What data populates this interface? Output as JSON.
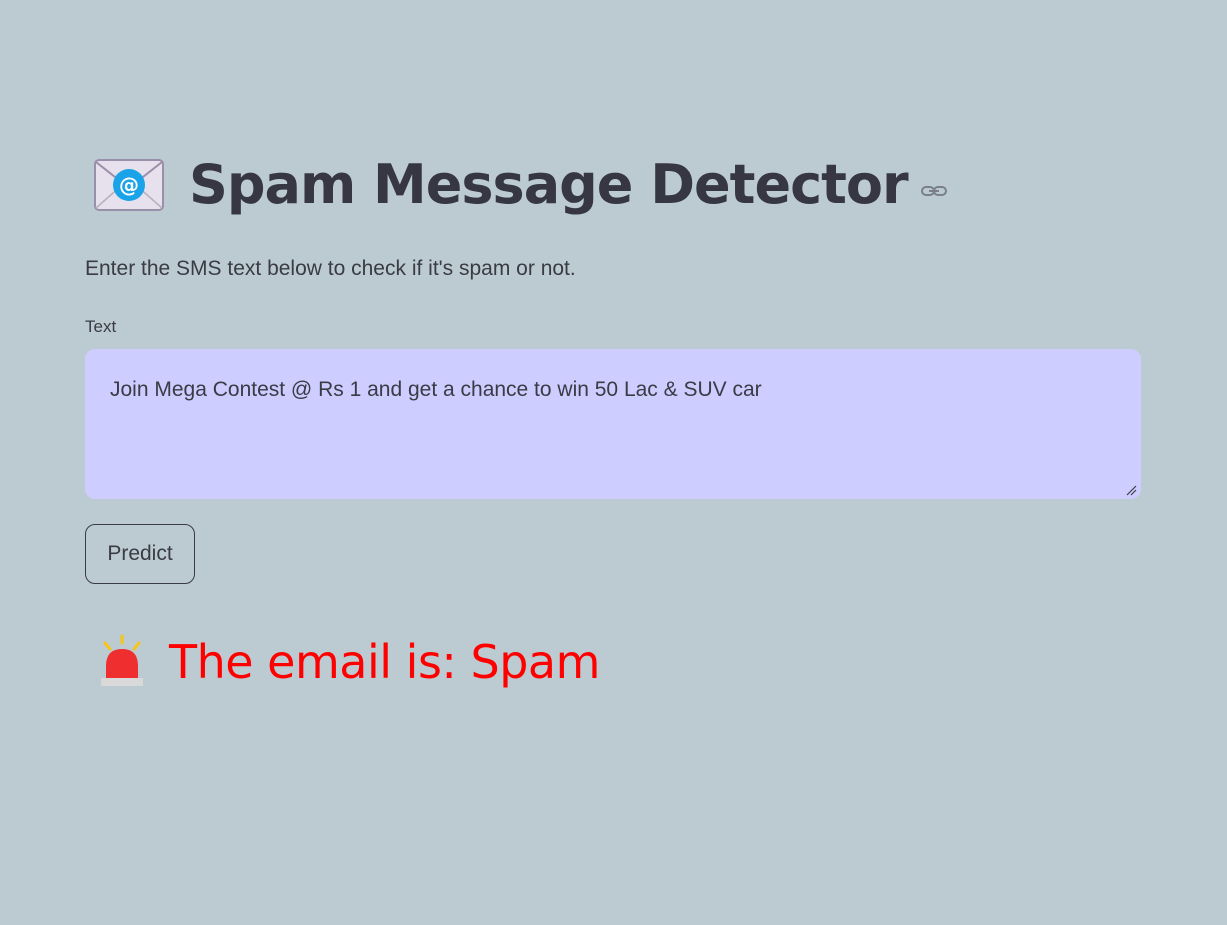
{
  "header": {
    "title": "Spam Message Detector",
    "title_icon": "envelope-with-at-icon",
    "anchor_icon": "link-icon"
  },
  "intro": {
    "text": "Enter the SMS text below to check if it's spam or not."
  },
  "form": {
    "label": "Text",
    "value": "Join Mega Contest @ Rs 1 and get a chance to win 50 Lac & SUV car",
    "button_label": "Predict"
  },
  "result": {
    "icon": "siren-icon",
    "text": "The email is: Spam",
    "color": "#ff0000"
  },
  "theme": {
    "background": "#bccbd1",
    "textarea_background": "#cdcdff"
  }
}
